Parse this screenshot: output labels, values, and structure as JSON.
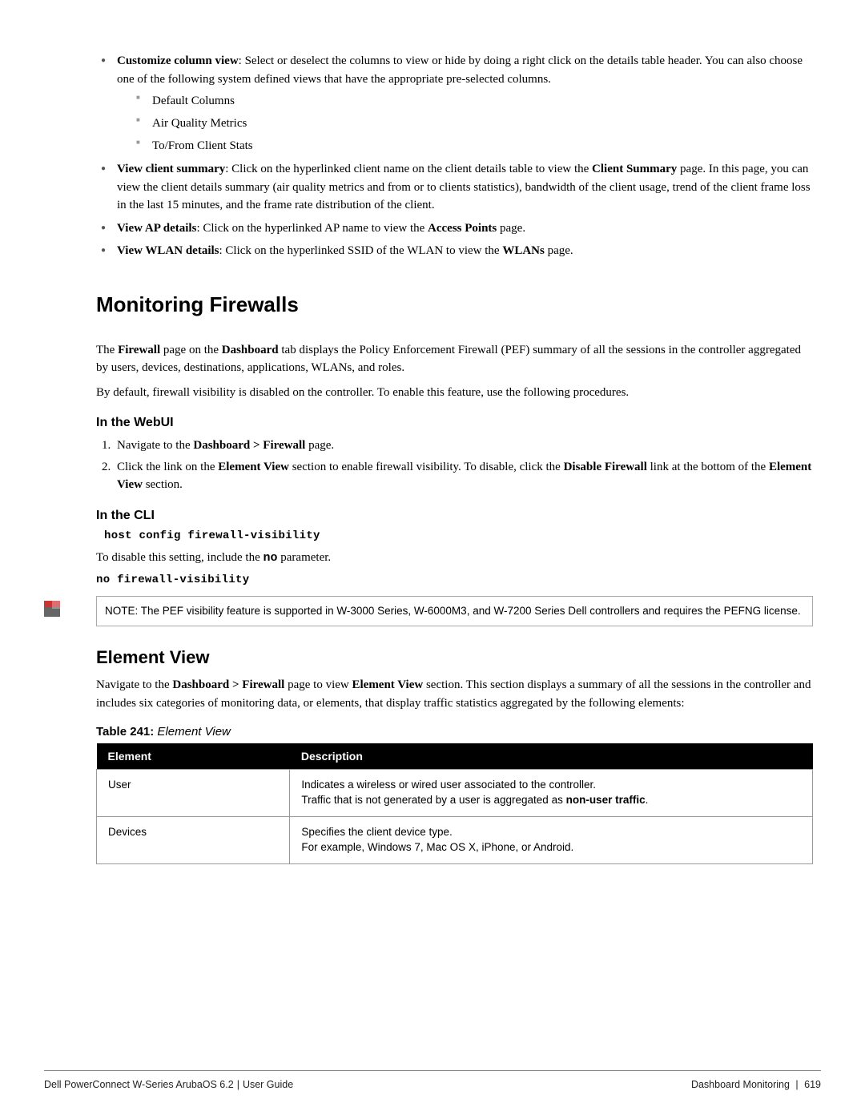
{
  "bullets": {
    "customize": {
      "label": "Customize column view",
      "text": ": Select or deselect the columns to view or hide by doing a right click on the details table header. You can also choose one of the following system defined views that have the appropriate pre-selected columns.",
      "subs": [
        "Default Columns",
        "Air Quality Metrics",
        "To/From Client Stats"
      ]
    },
    "view_client": {
      "label": "View client summary",
      "pre": ": Click on the hyperlinked client name on the client details table to view the ",
      "bold1": "Client Summary",
      "post": " page. In this page, you can view the client details summary (air quality metrics and from or to clients statistics), bandwidth of the client usage, trend of the client frame loss in the last 15 minutes, and the frame rate distribution of the client."
    },
    "view_ap": {
      "label": "View AP details",
      "pre": ": Click on the hyperlinked AP name to view the ",
      "bold1": "Access Points",
      "post": " page."
    },
    "view_wlan": {
      "label": "View WLAN details",
      "pre": ": Click on the hyperlinked SSID of the WLAN to view the ",
      "bold1": "WLANs",
      "post": " page."
    }
  },
  "h1": "Monitoring Firewalls",
  "intro": {
    "p1a": "The ",
    "p1b": "Firewall",
    "p1c": " page on the ",
    "p1d": "Dashboard",
    "p1e": " tab displays the Policy Enforcement Firewall (PEF) summary of all the sessions in the controller aggregated by users, devices, destinations, applications, WLANs, and roles.",
    "p2": "By default, firewall visibility is disabled on the controller. To enable this feature, use the following procedures."
  },
  "webui": {
    "heading": "In the WebUI",
    "s1a": "Navigate to the ",
    "s1b": "Dashboard > Firewall",
    "s1c": " page.",
    "s2a": "Click the link on the ",
    "s2b": "Element View",
    "s2c": " section to enable firewall visibility. To disable, click the ",
    "s2d": "Disable Firewall",
    "s2e": " link at the bottom of the ",
    "s2f": "Element View",
    "s2g": " section."
  },
  "cli": {
    "heading": "In the CLI",
    "cmd1": "host  config   firewall-visibility",
    "disable_a": "To disable this setting, include the ",
    "disable_b": "no",
    "disable_c": " parameter.",
    "cmd2": "no firewall-visibility"
  },
  "note": "NOTE: The PEF visibility feature is supported in W-3000 Series, W-6000M3, and W-7200 Series  Dell controllers and requires the PEFNG license.",
  "element_view": {
    "heading": "Element View",
    "p_a": "Navigate to the ",
    "p_b": "Dashboard > Firewall",
    "p_c": " page to view ",
    "p_d": "Element View",
    "p_e": " section. This section displays a summary of all the sessions in the controller and includes six categories of monitoring data, or elements, that display traffic statistics aggregated by the following elements:"
  },
  "table": {
    "caption_bold": "Table 241:",
    "caption_ital": " Element View",
    "head1": "Element",
    "head2": "Description",
    "rows": [
      {
        "el": "User",
        "d1": "Indicates a wireless or wired user associated to the controller.",
        "d2a": "Traffic that is not generated by a user is aggregated as ",
        "d2b": "non-user traffic",
        "d2c": "."
      },
      {
        "el": "Devices",
        "d1": "Specifies the client device type.",
        "d2a": "For example, Windows 7, Mac OS X, iPhone, or Android.",
        "d2b": "",
        "d2c": ""
      }
    ]
  },
  "footer": {
    "left": "Dell PowerConnect W-Series ArubaOS 6.2",
    "left2": "User Guide",
    "right1": "Dashboard Monitoring",
    "right2": "619"
  }
}
